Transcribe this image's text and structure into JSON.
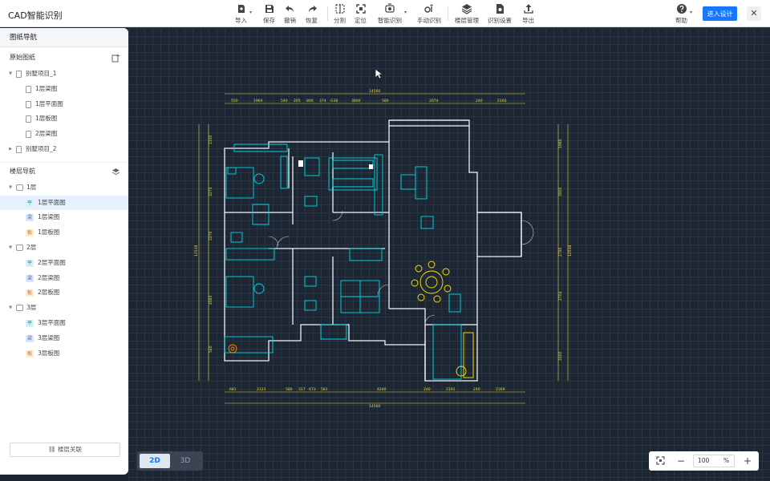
{
  "app": {
    "title": "CAD智能识别"
  },
  "toolbar": {
    "import": "导入",
    "save": "保存",
    "undo": "撤销",
    "redo": "恢复",
    "split": "分割",
    "locate": "定位",
    "smart_recognize": "智能识别",
    "manual_recognize": "手动识别",
    "floor_manage": "楼层管理",
    "recognize_settings": "识别设置",
    "export": "导出",
    "help": "帮助",
    "enter_design": "进入设计",
    "close": "✕"
  },
  "sidebar": {
    "header": "图纸导航",
    "source_section": "原始图纸",
    "projects": [
      {
        "name": "别墅项目_1",
        "expanded": true,
        "files": [
          "1层梁图",
          "1层平面图",
          "1层板图",
          "2层梁图"
        ]
      },
      {
        "name": "别墅项目_2",
        "expanded": false,
        "files": []
      }
    ],
    "floor_section": "楼层导航",
    "floors": [
      {
        "name": "1层",
        "items": [
          {
            "badge": "平",
            "label": "1层平面图",
            "selected": true
          },
          {
            "badge": "梁",
            "label": "1层梁图"
          },
          {
            "badge": "板",
            "label": "1层板图"
          }
        ]
      },
      {
        "name": "2层",
        "items": [
          {
            "badge": "平",
            "label": "2层平面图"
          },
          {
            "badge": "梁",
            "label": "2层梁图"
          },
          {
            "badge": "板",
            "label": "2层板图"
          }
        ]
      },
      {
        "name": "3层",
        "items": [
          {
            "badge": "平",
            "label": "3层平面图"
          },
          {
            "badge": "梁",
            "label": "3层梁图"
          },
          {
            "badge": "板",
            "label": "3层板图"
          }
        ]
      }
    ],
    "link_button": "楼层关联"
  },
  "canvas": {
    "view_2d": "2D",
    "view_3d": "3D",
    "zoom_value": "100",
    "zoom_unit": "%",
    "drawing": {
      "total_width": "14560",
      "top_dims": [
        "550",
        "1960",
        "540",
        "205",
        "800",
        "374",
        "G38",
        "3800",
        "580",
        "2074",
        "240",
        "2160"
      ],
      "bottom_dims": [
        "681",
        "2123",
        "580",
        "317",
        "673",
        "581",
        "4240",
        "240",
        "2191",
        "240",
        "2169"
      ],
      "left_dims": [
        "2330",
        "3273",
        "2270",
        "4583",
        "540"
      ],
      "right_dims": [
        "1960",
        "3900",
        "2790",
        "2704",
        "3300"
      ],
      "side_total": "12538"
    }
  },
  "colors": {
    "accent": "#1677ff",
    "canvas_bg": "#1d2633",
    "wall": "#ffffff",
    "fixture": "#00d8e8",
    "furniture": "#ffe500",
    "dim": "#e8d84a"
  }
}
